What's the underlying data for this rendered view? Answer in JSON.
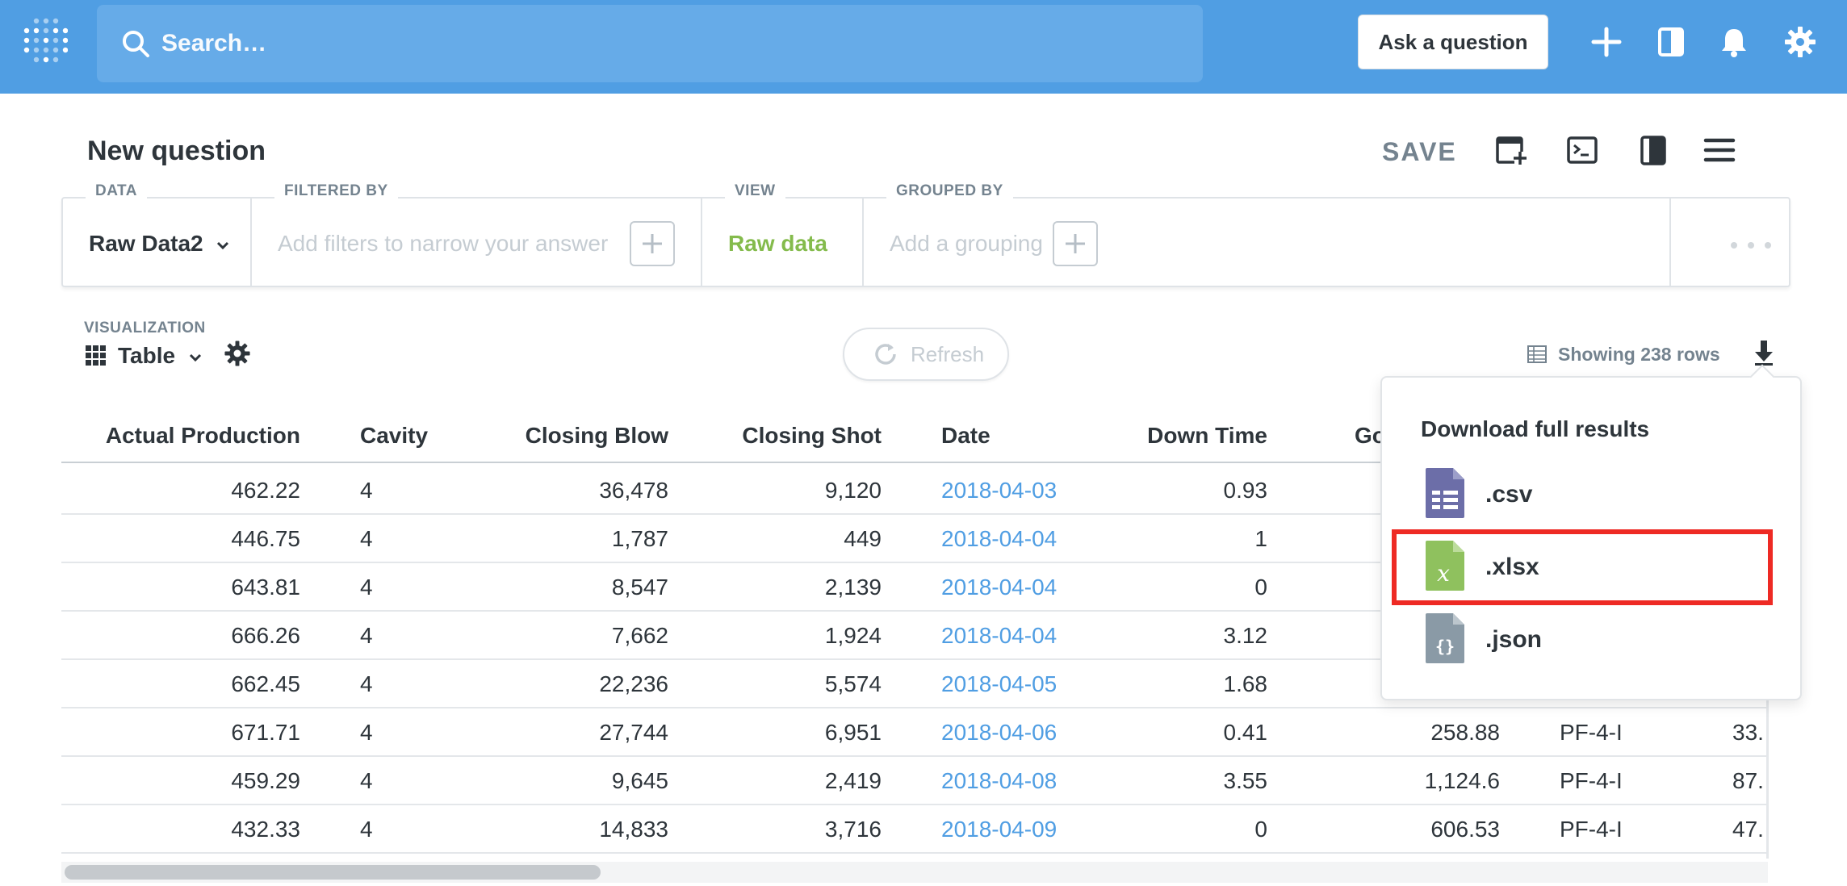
{
  "navbar": {
    "search_placeholder": "Search…",
    "ask_button": "Ask a question",
    "icons": [
      "plus-icon",
      "collection-icon",
      "bell-icon",
      "gear-icon"
    ]
  },
  "header": {
    "title": "New question",
    "save_label": "SAVE",
    "icons": [
      "add-to-dashboard-icon",
      "sql-editor-icon",
      "bookmark-icon",
      "menu-icon"
    ]
  },
  "query_builder": {
    "data_label": "DATA",
    "data_value": "Raw Data2",
    "filter_label": "FILTERED BY",
    "filter_placeholder": "Add filters to narrow your answer",
    "view_label": "VIEW",
    "view_value": "Raw data",
    "group_label": "GROUPED BY",
    "group_placeholder": "Add a grouping"
  },
  "visualization": {
    "label": "VISUALIZATION",
    "value": "Table",
    "refresh_label": "Refresh",
    "rows_text": "Showing 238 rows"
  },
  "table": {
    "columns": [
      "Actual Production",
      "Cavity",
      "Closing Blow",
      "Closing Shot",
      "Date",
      "Down Time",
      "Go"
    ],
    "rows": [
      [
        "462.22",
        "4",
        "36,478",
        "9,120",
        "2018-04-03",
        "0.93",
        "",
        "",
        ""
      ],
      [
        "446.75",
        "4",
        "1,787",
        "449",
        "2018-04-04",
        "1",
        "",
        "",
        ""
      ],
      [
        "643.81",
        "4",
        "8,547",
        "2,139",
        "2018-04-04",
        "0",
        "",
        "",
        ""
      ],
      [
        "666.26",
        "4",
        "7,662",
        "1,924",
        "2018-04-04",
        "3.12",
        "",
        "",
        ""
      ],
      [
        "662.45",
        "4",
        "22,236",
        "5,574",
        "2018-04-05",
        "1.68",
        "",
        "",
        ""
      ],
      [
        "671.71",
        "4",
        "27,744",
        "6,951",
        "2018-04-06",
        "0.41",
        "258.88",
        "PF-4-I",
        "33."
      ],
      [
        "459.29",
        "4",
        "9,645",
        "2,419",
        "2018-04-08",
        "3.55",
        "1,124.6",
        "PF-4-I",
        "87."
      ],
      [
        "432.33",
        "4",
        "14,833",
        "3,716",
        "2018-04-09",
        "0",
        "606.53",
        "PF-4-I",
        "47."
      ]
    ]
  },
  "download_popover": {
    "title": "Download full results",
    "options": [
      ".csv",
      ".xlsx",
      ".json"
    ],
    "highlighted": ".xlsx"
  },
  "colors": {
    "navbar": "#509ee3",
    "link": "#509ee3",
    "view_green": "#84bb4c",
    "highlight": "#ee2a24",
    "csv": "#6c6ea8",
    "xlsx": "#8fc15e",
    "json": "#8a9aa6"
  }
}
